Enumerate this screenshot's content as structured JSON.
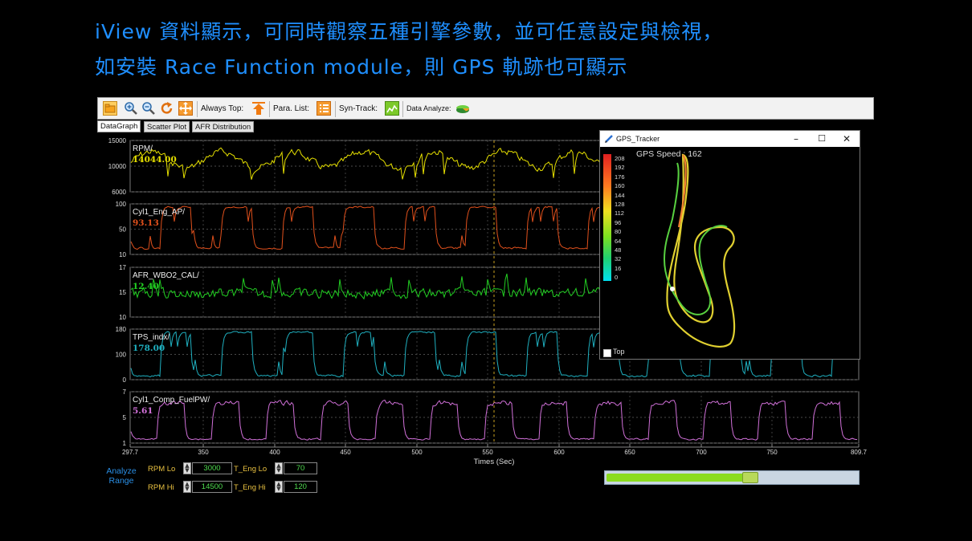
{
  "caption": {
    "line1": "iView 資料顯示，可同時觀察五種引擎參數，並可任意設定與檢視，",
    "line2": "如安裝 Race Function module，則 GPS 軌跡也可顯示"
  },
  "toolbar": {
    "icons": [
      "open-folder-icon",
      "zoom-in-icon",
      "zoom-out-icon",
      "refresh-icon",
      "move-icon"
    ],
    "always_top_label": "Always Top:",
    "para_list_label": "Para. List:",
    "syn_track_label": "Syn-Track:",
    "data_analyze_label": "Data Analyze:"
  },
  "tabs": [
    "DataGraph",
    "Scatter Plot",
    "AFR Distribution"
  ],
  "panels": [
    {
      "name": "RPM/",
      "value": "14044.00",
      "color": "#e6e000",
      "ticks": [
        "15000",
        "10000",
        "6000"
      ]
    },
    {
      "name": "Cyl1_Eng_AP/",
      "value": "93.13",
      "color": "#e0501c",
      "ticks": [
        "100",
        "50",
        "10"
      ]
    },
    {
      "name": "AFR_WBO2_CAL/",
      "value": "12.40",
      "color": "#22d022",
      "ticks": [
        "17",
        "15",
        "10"
      ]
    },
    {
      "name": "TPS_indx/",
      "value": "178.00",
      "color": "#1fb0c0",
      "ticks": [
        "180",
        "100",
        "0"
      ]
    },
    {
      "name": "Cyl1_Comp_FuelPW/",
      "value": "5.61",
      "color": "#d070d8",
      "ticks": [
        "7",
        "5",
        "1"
      ]
    }
  ],
  "x_axis": {
    "ticks": [
      "297.7",
      "350",
      "400",
      "450",
      "500",
      "550",
      "600",
      "650",
      "700",
      "750",
      "809.7"
    ],
    "label": "Times (Sec)"
  },
  "analyze": {
    "title": "Analyze\nRange",
    "rpm_lo_label": "RPM Lo",
    "rpm_lo": "3000",
    "rpm_hi_label": "RPM Hi",
    "rpm_hi": "14500",
    "teng_lo_label": "T_Eng Lo",
    "teng_lo": "70",
    "teng_hi_label": "T_Eng Hi",
    "teng_hi": "120"
  },
  "scrollbar": {
    "position": 0.58
  },
  "gps": {
    "title": "GPS_Tracker",
    "speed": "GPS Speed : 162",
    "scale": [
      "208",
      "192",
      "176",
      "160",
      "144",
      "128",
      "112",
      "96",
      "80",
      "64",
      "48",
      "32",
      "16",
      "0"
    ],
    "top_label": "Top"
  },
  "colors": {
    "caption": "#1f8fff",
    "background": "#000000",
    "grid": "#5a5a5a"
  }
}
